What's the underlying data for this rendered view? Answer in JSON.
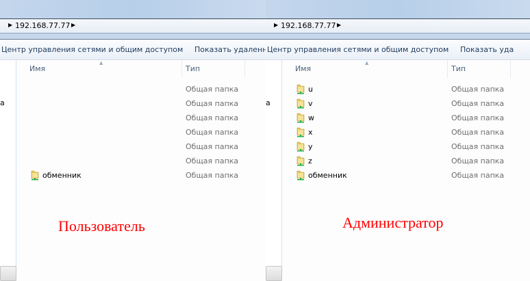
{
  "panes": [
    {
      "id": "user",
      "address": "192.168.77.77",
      "toolbar": [
        "Центр управления сетями и общим доступом",
        "Показать удаленны"
      ],
      "nav_text": "а",
      "columns": {
        "name": "Имя",
        "type": "Тип"
      },
      "rows": [
        {
          "name": "",
          "type": "Общая папка",
          "icon": false
        },
        {
          "name": "",
          "type": "Общая папка",
          "icon": false
        },
        {
          "name": "",
          "type": "Общая папка",
          "icon": false
        },
        {
          "name": "",
          "type": "Общая папка",
          "icon": false
        },
        {
          "name": "",
          "type": "Общая папка",
          "icon": false
        },
        {
          "name": "",
          "type": "Общая папка",
          "icon": false
        },
        {
          "name": "обменник",
          "type": "Общая папка",
          "icon": true
        }
      ],
      "caption": "Пользователь"
    },
    {
      "id": "admin",
      "address": "192.168.77.77",
      "toolbar": [
        "Центр управления сетями и общим доступом",
        "Показать уда"
      ],
      "nav_text": "а",
      "columns": {
        "name": "Имя",
        "type": "Тип"
      },
      "rows": [
        {
          "name": "u",
          "type": "Общая папка",
          "icon": true
        },
        {
          "name": "v",
          "type": "Общая папка",
          "icon": true
        },
        {
          "name": "w",
          "type": "Общая папка",
          "icon": true
        },
        {
          "name": "x",
          "type": "Общая папка",
          "icon": true
        },
        {
          "name": "y",
          "type": "Общая папка",
          "icon": true
        },
        {
          "name": "z",
          "type": "Общая папка",
          "icon": true
        },
        {
          "name": "обменник",
          "type": "Общая папка",
          "icon": true
        }
      ],
      "caption": "Администратор"
    }
  ],
  "colors": {
    "caption": "#ff0000",
    "folder": "#e8c85a",
    "share": "#1fae4b"
  }
}
